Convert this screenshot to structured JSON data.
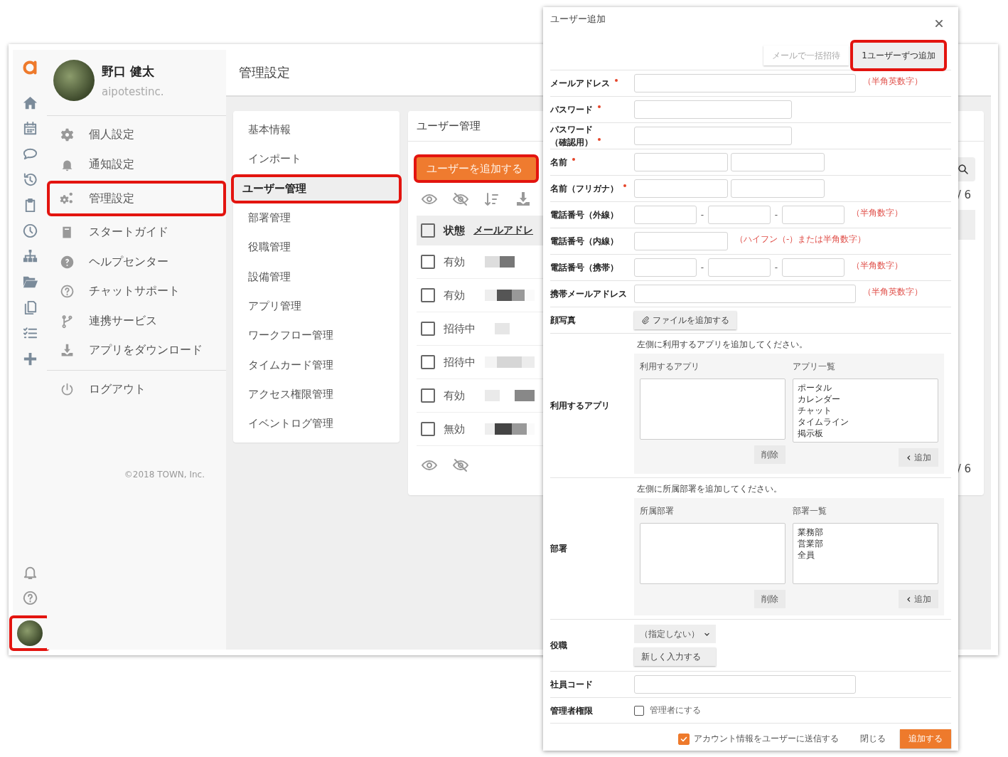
{
  "rail": {
    "avatar_highlighted": true
  },
  "profile": {
    "name": "野口 健太",
    "org": "aipotestinc."
  },
  "settings_menu": [
    {
      "label": "個人設定",
      "highlighted": false
    },
    {
      "label": "通知設定",
      "highlighted": false
    },
    {
      "label": "管理設定",
      "highlighted": true
    },
    {
      "label": "スタートガイド",
      "highlighted": false
    },
    {
      "label": "ヘルプセンター",
      "highlighted": false
    },
    {
      "label": "チャットサポート",
      "highlighted": false
    },
    {
      "label": "連携サービス",
      "highlighted": false
    },
    {
      "label": "アプリをダウンロード",
      "highlighted": false
    }
  ],
  "logout": "ログアウト",
  "copyright": "©2018 TOWN, Inc.",
  "page_title": "管理設定",
  "admin_menu": [
    {
      "label": "基本情報",
      "selected": false,
      "highlighted": false
    },
    {
      "label": "インポート",
      "selected": false,
      "highlighted": false
    },
    {
      "label": "ユーザー管理",
      "selected": true,
      "highlighted": true
    },
    {
      "label": "部署管理",
      "selected": false,
      "highlighted": false
    },
    {
      "label": "役職管理",
      "selected": false,
      "highlighted": false
    },
    {
      "label": "設備管理",
      "selected": false,
      "highlighted": false
    },
    {
      "label": "アプリ管理",
      "selected": false,
      "highlighted": false
    },
    {
      "label": "ワークフロー管理",
      "selected": false,
      "highlighted": false
    },
    {
      "label": "タイムカード管理",
      "selected": false,
      "highlighted": false
    },
    {
      "label": "アクセス権限管理",
      "selected": false,
      "highlighted": false
    },
    {
      "label": "イベントログ管理",
      "selected": false,
      "highlighted": false
    }
  ],
  "user_panel": {
    "title": "ユーザー管理",
    "add_button": {
      "label": "ユーザーを追加する",
      "highlighted": true
    },
    "select_all_checked": false,
    "columns": [
      "状態",
      "メールアドレ"
    ],
    "rows": [
      {
        "status": "有効",
        "checked": false
      },
      {
        "status": "有効",
        "checked": false
      },
      {
        "status": "招待中",
        "checked": false
      },
      {
        "status": "招待中",
        "checked": false
      },
      {
        "status": "有効",
        "checked": false
      },
      {
        "status": "無効",
        "checked": false
      }
    ],
    "pager_top": "/ 6",
    "pager_bottom": "/ 6"
  },
  "modal": {
    "title": "ユーザー追加",
    "tabs": [
      {
        "label": "メールで一括招待",
        "selected": false,
        "highlighted": false
      },
      {
        "label": "1ユーザーずつ追加",
        "selected": true,
        "highlighted": true
      }
    ],
    "fields": [
      {
        "kind": "wide",
        "label": "メールアドレス",
        "required": true,
        "note": "（半角英数字）"
      },
      {
        "kind": "medium",
        "label": "パスワード",
        "required": true
      },
      {
        "kind": "medium",
        "label": "パスワード（確認用）",
        "required": true
      },
      {
        "kind": "pair",
        "label": "名前",
        "required": true
      },
      {
        "kind": "pair",
        "label": "名前（フリガナ）",
        "required": true
      },
      {
        "kind": "phone",
        "label": "電話番号（外線）",
        "separators": [
          "-",
          "-"
        ],
        "note": "（半角数字）"
      },
      {
        "kind": "short",
        "label": "電話番号（内線）",
        "note": "（ハイフン（-）または半角数字）"
      },
      {
        "kind": "phone",
        "label": "電話番号（携帯）",
        "separators": [
          "-",
          "-"
        ],
        "note": "（半角数字）"
      },
      {
        "kind": "wide",
        "label": "携帯メールアドレス",
        "note": "（半角英数字）"
      },
      {
        "kind": "file",
        "label": "顔写真",
        "button": "ファイルを追加する"
      },
      {
        "kind": "picker",
        "label": "利用するアプリ",
        "hint": "左側に利用するアプリを追加してください。",
        "left_title": "利用するアプリ",
        "right_title": "アプリ一覧",
        "right_items": [
          "ポータル",
          "カレンダー",
          "チャット",
          "タイムライン",
          "掲示板"
        ],
        "remove": "削除",
        "add": "追加"
      },
      {
        "kind": "picker",
        "label": "部署",
        "hint": "左側に所属部署を追加してください。",
        "left_title": "所属部署",
        "right_title": "部署一覧",
        "right_items": [
          "業務部",
          "営業部",
          "全員"
        ],
        "remove": "削除",
        "add": "追加"
      },
      {
        "kind": "select",
        "label": "役職",
        "value": "（指定しない）",
        "button": "新しく入力する"
      },
      {
        "kind": "wide",
        "label": "社員コード"
      },
      {
        "kind": "checkbox",
        "label": "管理者権限",
        "checked": false,
        "text": "管理者にする"
      }
    ],
    "send_info": {
      "checked": true,
      "text": "アカウント情報をユーザーに送信する"
    },
    "close": "閉じる",
    "submit": "追加する"
  }
}
